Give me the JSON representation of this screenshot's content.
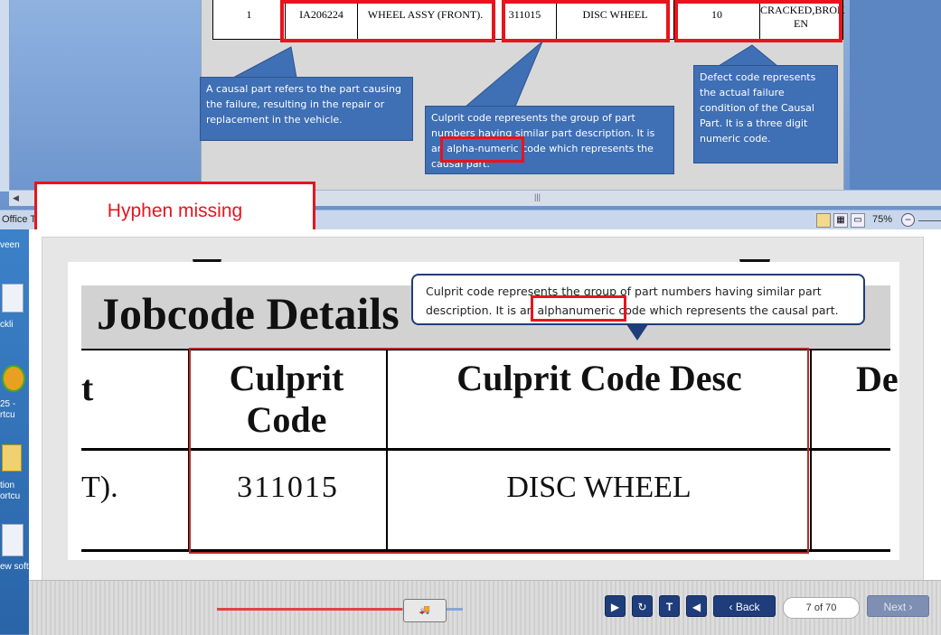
{
  "top_table": {
    "row": [
      "1",
      "IA206224",
      "WHEEL ASSY (FRONT).",
      "311015",
      "DISC WHEEL",
      "10",
      "CRACKED,BROK EN"
    ]
  },
  "callouts": {
    "causal": "A causal part refers to the part causing the failure, resulting in the repair or replacement in the vehicle.",
    "culprit_top": "Culprit code represents the group of part numbers having similar part description. It is an alpha-numeric code which represents the causal part.",
    "defect": "Defect code represents the actual failure condition of the Causal Part. It is a three digit numeric code.",
    "culprit_bottom": "Culprit code represents the group of part numbers having similar part description. It is an alphanumeric code which represents the causal part."
  },
  "annotation": {
    "label": "Hyphen missing",
    "color": "#e8141d"
  },
  "statusbar": {
    "app_text": "Office T",
    "zoom": "75%"
  },
  "desktop_icons": [
    "veen",
    "ckli",
    "25 - rtcu",
    "tion ortcu",
    "ew soft"
  ],
  "slide": {
    "heading": "Jobcode Details",
    "col_partial_left": "t",
    "col1": "Culprit Code",
    "col2": "Culprit Code Desc",
    "col_partial_right": "De",
    "row_partial_left": "T).",
    "row_code": "311015",
    "row_desc": "DISC WHEEL"
  },
  "nav": {
    "back": "Back",
    "page": "7 of 70",
    "next": "Next"
  }
}
